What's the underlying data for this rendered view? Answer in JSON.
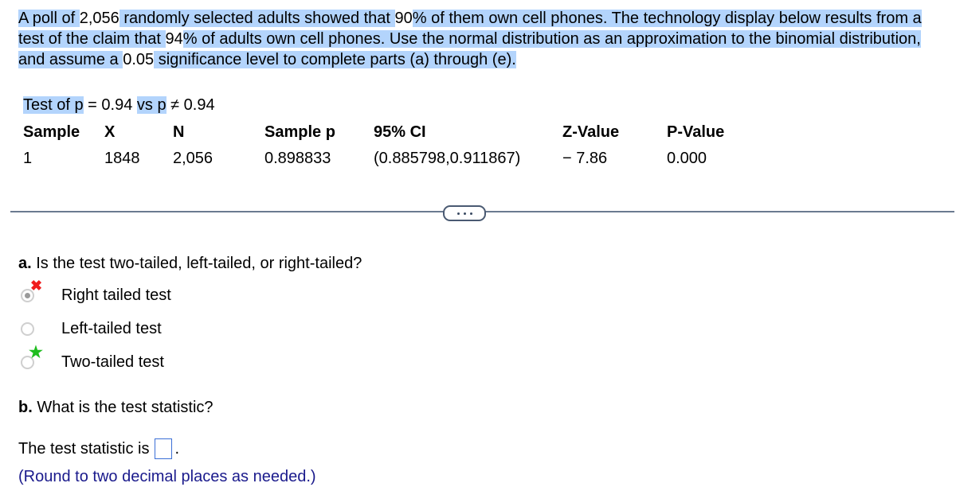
{
  "intro": {
    "segments": [
      {
        "text": "A poll of ",
        "hl": true
      },
      {
        "text": "2,056",
        "hl": false
      },
      {
        "text": " randomly selected adults showed that ",
        "hl": true
      },
      {
        "text": "90",
        "hl": false
      },
      {
        "text": "% of them own cell phones. The technology display below results from a test of the claim that ",
        "hl": true
      },
      {
        "text": "94",
        "hl": false
      },
      {
        "text": "% of adults own cell phones. Use the normal distribution as an approximation to the binomial distribution, and assume a ",
        "hl": true
      },
      {
        "text": "0.05",
        "hl": false
      },
      {
        "text": " significance level to complete parts (a) through (e).",
        "hl": true
      }
    ]
  },
  "test_display": {
    "test_label": "Test of p",
    "eq": " = 0.94 ",
    "vs_label": "vs p",
    "neq": " ≠ 0.94",
    "headers": [
      "Sample",
      "X",
      "N",
      "Sample p",
      "95% CI",
      "Z-Value",
      "P-Value"
    ],
    "row": [
      "1",
      "1848",
      "2,056",
      "0.898833",
      "(0.885798,0.911867)",
      "− 7.86",
      "0.000"
    ]
  },
  "divider": {
    "more_label": "more"
  },
  "part_a": {
    "prefix": "a.",
    "question": " Is the test two-tailed, left-tailed, or right-tailed?",
    "options": [
      {
        "label": "Right tailed test",
        "selected": true,
        "feedback": "incorrect"
      },
      {
        "label": "Left-tailed test",
        "selected": false,
        "feedback": "none"
      },
      {
        "label": "Two-tailed test",
        "selected": false,
        "feedback": "correct"
      }
    ]
  },
  "part_b": {
    "prefix": "b.",
    "question": " What is the test statistic?",
    "statement_before": "The test statistic is",
    "statement_after": ".",
    "answer_value": "",
    "hint": "(Round to two decimal places as needed.)"
  },
  "colors": {
    "selection_highlight": "#b3d4fc",
    "incorrect": "#f01c1c",
    "correct": "#1fbd1f",
    "hint_text": "#1a1a8c",
    "input_border": "#3b6fd6"
  },
  "icons": {
    "incorrect": "✖",
    "correct": "★"
  }
}
